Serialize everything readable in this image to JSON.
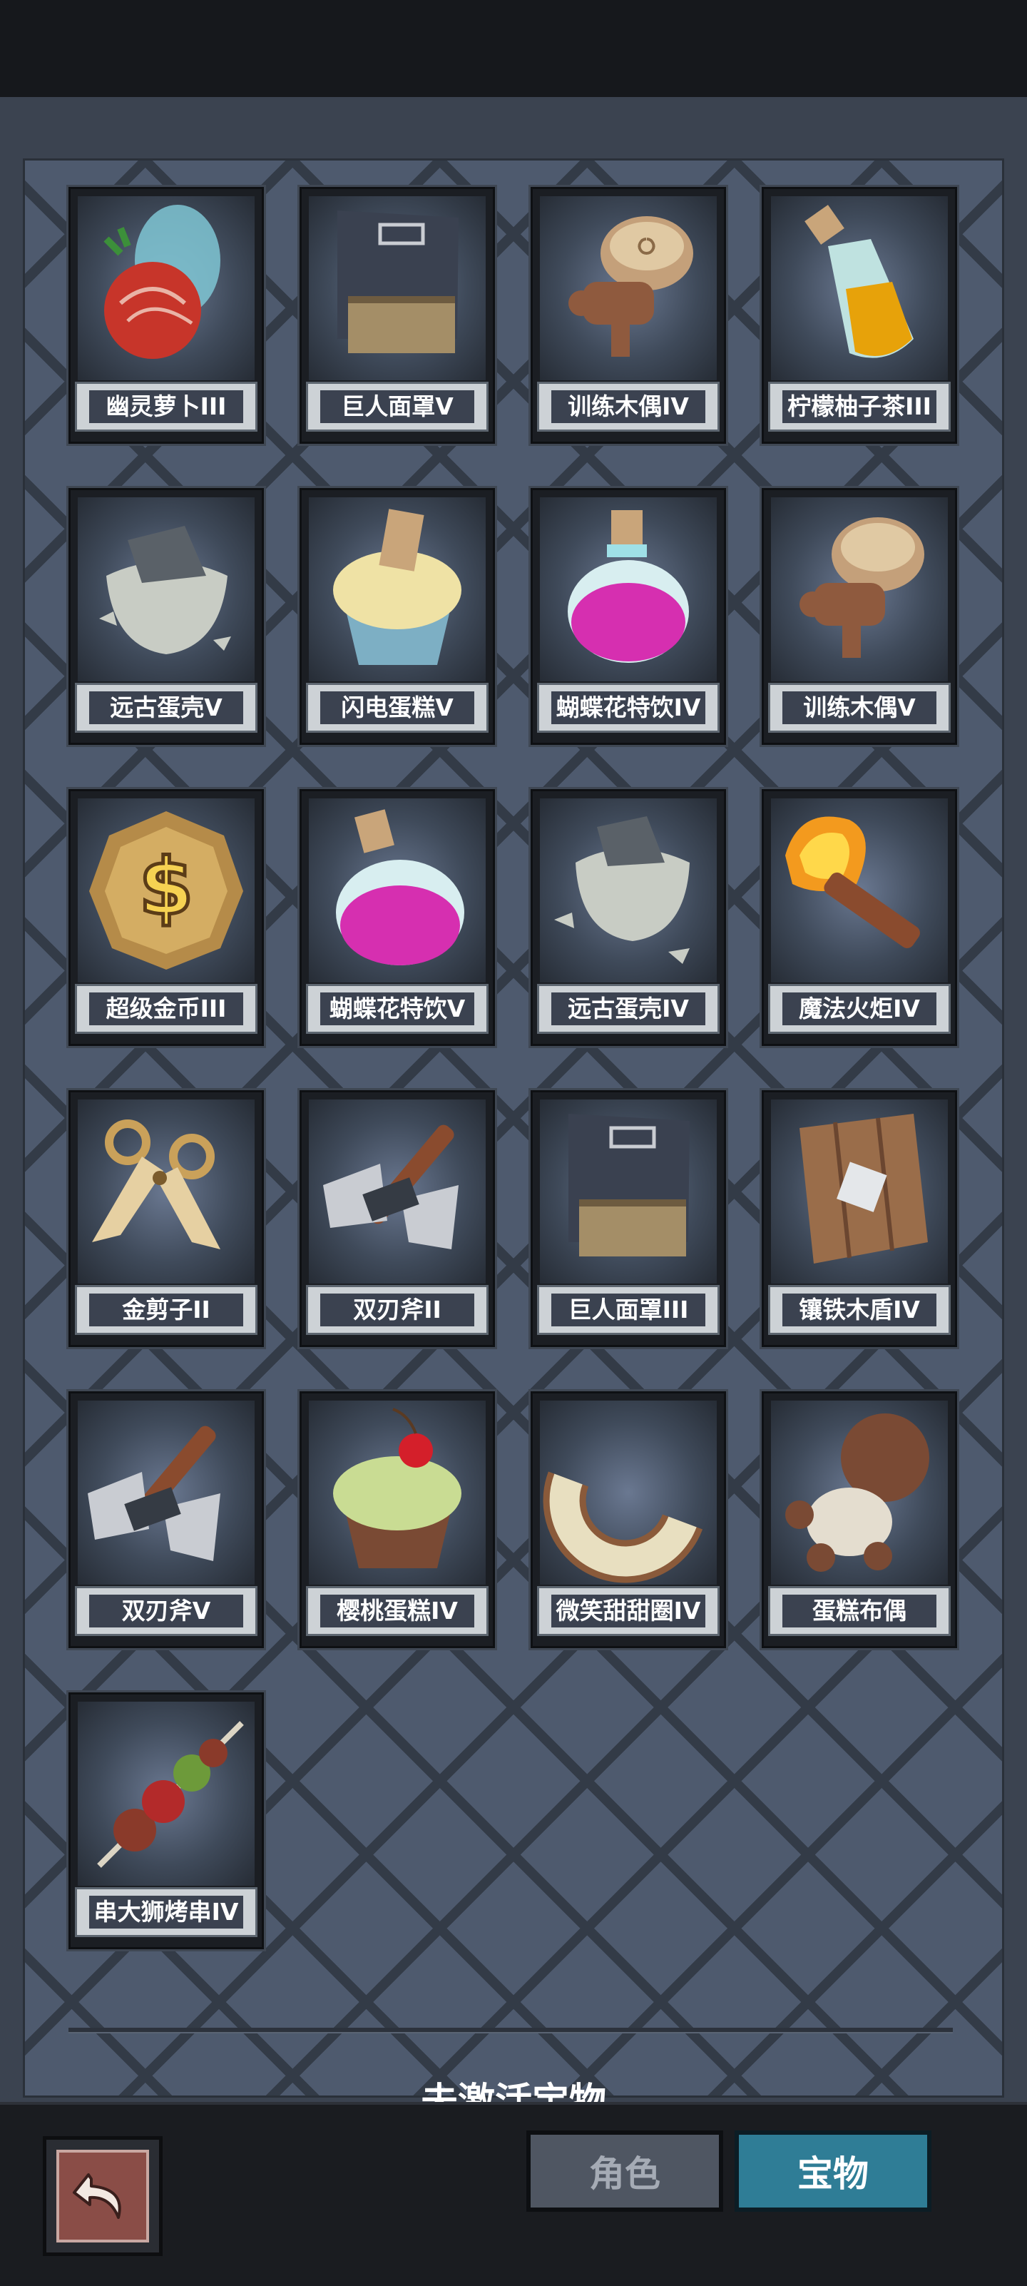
{
  "treasures": [
    {
      "name": "幽灵萝卜III",
      "icon": "ghost-radish-icon"
    },
    {
      "name": "巨人面罩V",
      "icon": "giant-mask-icon"
    },
    {
      "name": "训练木偶IV",
      "icon": "training-dummy-icon"
    },
    {
      "name": "柠檬柚子茶III",
      "icon": "lemon-tea-bottle-icon"
    },
    {
      "name": "远古蛋壳V",
      "icon": "ancient-eggshell-icon"
    },
    {
      "name": "闪电蛋糕V",
      "icon": "lightning-cupcake-icon"
    },
    {
      "name": "蝴蝶花特饮IV",
      "icon": "pink-potion-icon"
    },
    {
      "name": "训练木偶V",
      "icon": "training-dummy-icon"
    },
    {
      "name": "超级金币III",
      "icon": "gold-coin-icon"
    },
    {
      "name": "蝴蝶花特饮V",
      "icon": "pink-potion-icon"
    },
    {
      "name": "远古蛋壳IV",
      "icon": "ancient-eggshell-icon"
    },
    {
      "name": "魔法火炬IV",
      "icon": "magic-torch-icon"
    },
    {
      "name": "金剪子II",
      "icon": "golden-scissors-icon"
    },
    {
      "name": "双刃斧II",
      "icon": "double-axe-icon"
    },
    {
      "name": "巨人面罩III",
      "icon": "giant-mask-icon"
    },
    {
      "name": "镶铁木盾IV",
      "icon": "iron-wood-shield-icon"
    },
    {
      "name": "双刃斧V",
      "icon": "double-axe-icon"
    },
    {
      "name": "樱桃蛋糕IV",
      "icon": "cherry-cupcake-icon"
    },
    {
      "name": "微笑甜甜圈IV",
      "icon": "smile-donut-icon"
    },
    {
      "name": "蛋糕布偶",
      "icon": "cake-doll-icon"
    },
    {
      "name": "串大狮烤串IV",
      "icon": "kebab-skewer-icon"
    }
  ],
  "section_title": "未激活宝物",
  "nav": {
    "back_icon": "back-arrow-icon",
    "tab_role": "角色",
    "tab_treasure": "宝物",
    "active_tab": "宝物"
  },
  "colors": {
    "tab_active": "#2f7d96",
    "tab_inactive": "#4f5662",
    "back_button": "#8a4d47"
  }
}
